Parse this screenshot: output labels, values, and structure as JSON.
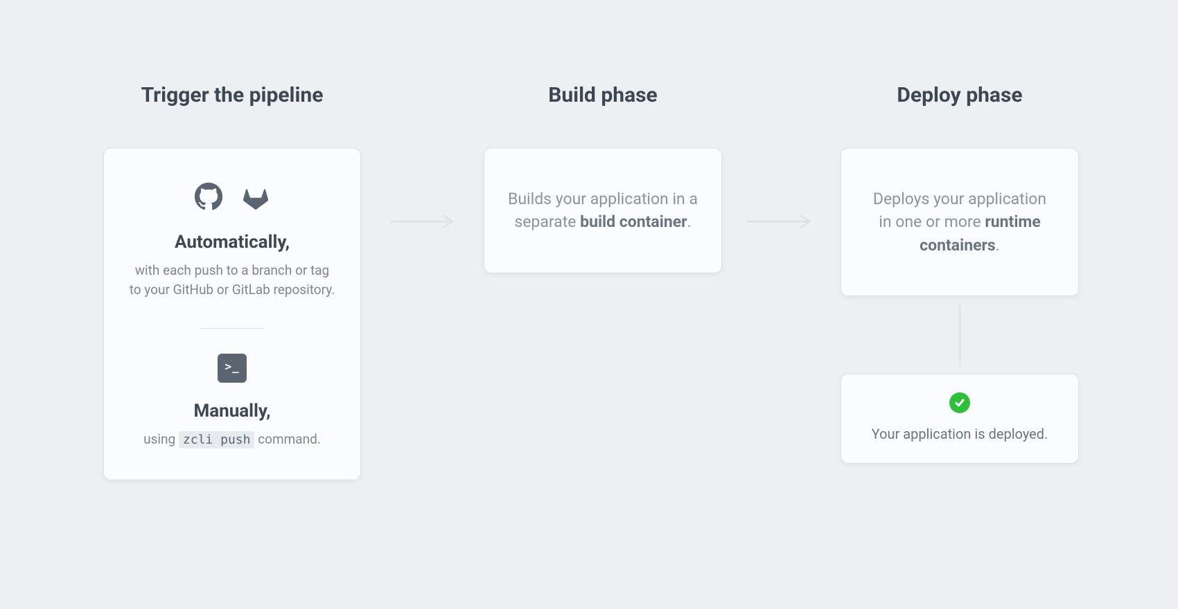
{
  "columns": {
    "trigger": {
      "title": "Trigger the pipeline"
    },
    "build": {
      "title": "Build phase"
    },
    "deploy": {
      "title": "Deploy phase"
    }
  },
  "trigger": {
    "auto": {
      "heading": "Automatically,",
      "sub": "with each push to a branch or tag to your GitHub or GitLab repository."
    },
    "manual": {
      "heading": "Manually,",
      "sub_prefix": "using ",
      "code": "zcli push",
      "sub_suffix": " command."
    }
  },
  "build": {
    "text_prefix": "Builds your application in a separate ",
    "bold": "build container",
    "text_suffix": "."
  },
  "deploy": {
    "text_prefix": "Deploys your application in one or more ",
    "bold": "runtime containers",
    "text_suffix": "."
  },
  "deployed": {
    "text": "Your application is deployed."
  },
  "colors": {
    "success": "#2fbf3a",
    "icon": "#5a6571"
  }
}
